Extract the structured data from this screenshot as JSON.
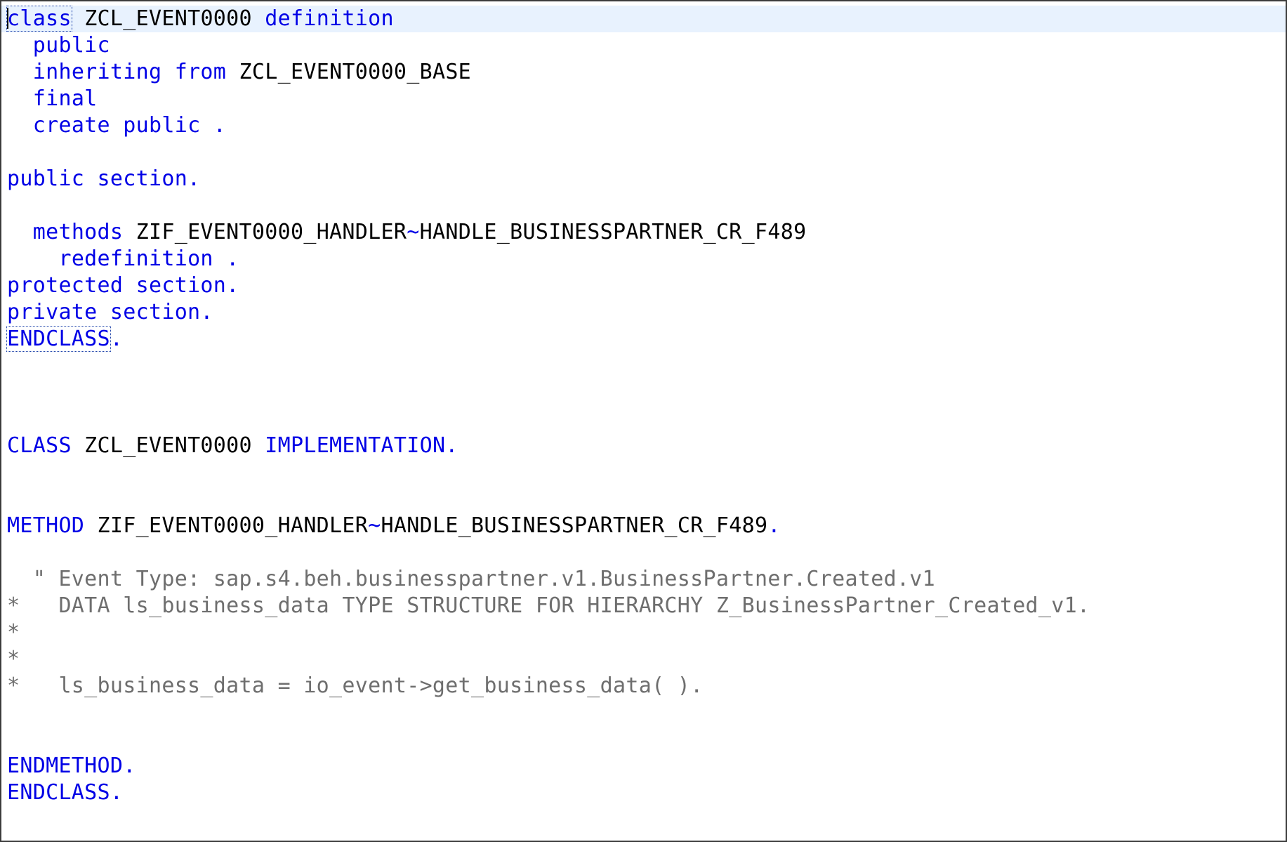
{
  "code": {
    "lines": [
      {
        "tokens": [
          {
            "t": "class",
            "c": "kw"
          },
          {
            "t": " ",
            "c": "id"
          },
          {
            "t": "ZCL_EVENT0000",
            "c": "id"
          },
          {
            "t": " ",
            "c": "id"
          },
          {
            "t": "definition",
            "c": "kw"
          }
        ]
      },
      {
        "tokens": [
          {
            "t": "  ",
            "c": "id"
          },
          {
            "t": "public",
            "c": "kw"
          }
        ]
      },
      {
        "tokens": [
          {
            "t": "  ",
            "c": "id"
          },
          {
            "t": "inheriting from",
            "c": "kw"
          },
          {
            "t": " ZCL_EVENT0000_BASE",
            "c": "id"
          }
        ]
      },
      {
        "tokens": [
          {
            "t": "  ",
            "c": "id"
          },
          {
            "t": "final",
            "c": "kw"
          }
        ]
      },
      {
        "tokens": [
          {
            "t": "  ",
            "c": "id"
          },
          {
            "t": "create public .",
            "c": "kw"
          }
        ]
      },
      {
        "tokens": []
      },
      {
        "tokens": [
          {
            "t": "public section.",
            "c": "kw"
          }
        ]
      },
      {
        "tokens": []
      },
      {
        "tokens": [
          {
            "t": "  ",
            "c": "id"
          },
          {
            "t": "methods",
            "c": "kw"
          },
          {
            "t": " ZIF_EVENT0000_HANDLER",
            "c": "id"
          },
          {
            "t": "~",
            "c": "kw"
          },
          {
            "t": "HANDLE_BUSINESSPARTNER_CR_F489",
            "c": "id"
          }
        ]
      },
      {
        "tokens": [
          {
            "t": "    ",
            "c": "id"
          },
          {
            "t": "redefinition .",
            "c": "kw"
          }
        ]
      },
      {
        "tokens": [
          {
            "t": "protected section.",
            "c": "kw"
          }
        ]
      },
      {
        "tokens": [
          {
            "t": "private section.",
            "c": "kw"
          }
        ]
      },
      {
        "tokens": [
          {
            "t": "ENDCLASS",
            "c": "kw"
          },
          {
            "t": ".",
            "c": "kw"
          }
        ]
      },
      {
        "tokens": []
      },
      {
        "tokens": []
      },
      {
        "tokens": []
      },
      {
        "tokens": [
          {
            "t": "CLASS",
            "c": "kw"
          },
          {
            "t": " ZCL_EVENT0000 ",
            "c": "id"
          },
          {
            "t": "IMPLEMENTATION.",
            "c": "kw"
          }
        ]
      },
      {
        "tokens": []
      },
      {
        "tokens": []
      },
      {
        "tokens": [
          {
            "t": "METHOD",
            "c": "kw"
          },
          {
            "t": " ZIF_EVENT0000_HANDLER",
            "c": "id"
          },
          {
            "t": "~",
            "c": "kw"
          },
          {
            "t": "HANDLE_BUSINESSPARTNER_CR_F489",
            "c": "id"
          },
          {
            "t": ".",
            "c": "kw"
          }
        ]
      },
      {
        "tokens": []
      },
      {
        "tokens": [
          {
            "t": "  \" Event Type: sap.s4.beh.businesspartner.v1.BusinessPartner.Created.v1",
            "c": "cm"
          }
        ]
      },
      {
        "tokens": [
          {
            "t": "*   DATA ls_business_data TYPE STRUCTURE FOR HIERARCHY Z_BusinessPartner_Created_v1.",
            "c": "cm"
          }
        ]
      },
      {
        "tokens": [
          {
            "t": "*",
            "c": "cm"
          }
        ]
      },
      {
        "tokens": [
          {
            "t": "*",
            "c": "cm"
          }
        ]
      },
      {
        "tokens": [
          {
            "t": "*   ls_business_data = io_event->get_business_data( ).",
            "c": "cm"
          }
        ]
      },
      {
        "tokens": []
      },
      {
        "tokens": []
      },
      {
        "tokens": [
          {
            "t": "ENDMETHOD.",
            "c": "kw"
          }
        ]
      },
      {
        "tokens": [
          {
            "t": "ENDCLASS.",
            "c": "kw"
          }
        ]
      }
    ],
    "current_line": 0,
    "boxed_tokens": [
      {
        "line": 0,
        "token": 0
      },
      {
        "line": 12,
        "token": 0
      }
    ]
  },
  "colors": {
    "keyword": "#0000e6",
    "identifier": "#000000",
    "comment": "#6e6e6e",
    "current_line_bg": "#e8f2fe"
  }
}
